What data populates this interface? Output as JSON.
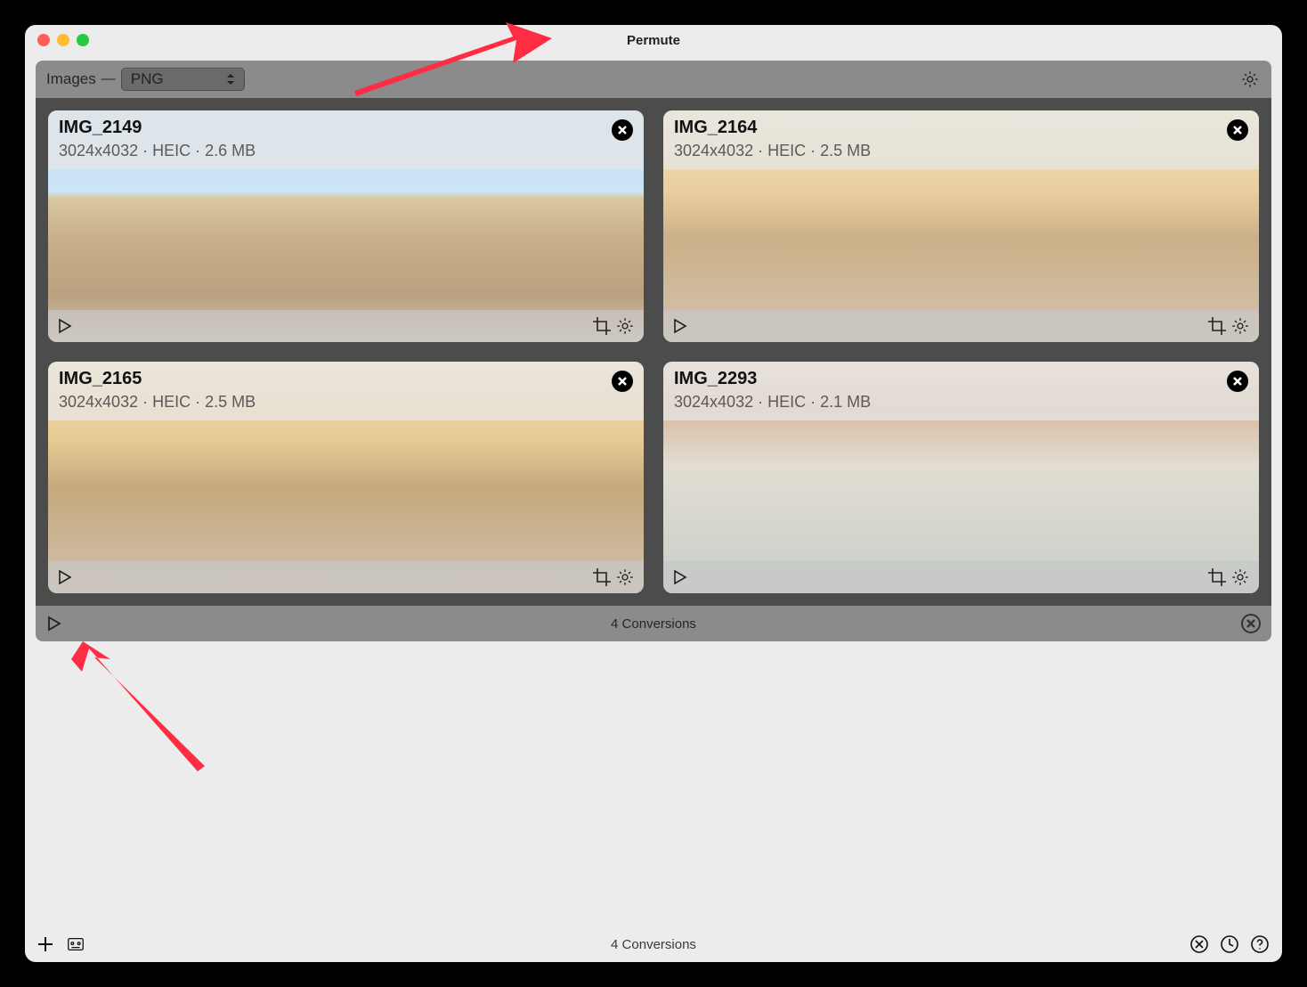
{
  "window": {
    "title": "Permute"
  },
  "panel": {
    "type_label": "Images",
    "format_selected": "PNG",
    "footer_text": "4 Conversions"
  },
  "cards": [
    {
      "name": "IMG_2149",
      "dimensions": "3024x4032",
      "format": "HEIC",
      "size": "2.6 MB",
      "scene": "scene1"
    },
    {
      "name": "IMG_2164",
      "dimensions": "3024x4032",
      "format": "HEIC",
      "size": "2.5 MB",
      "scene": "scene2"
    },
    {
      "name": "IMG_2165",
      "dimensions": "3024x4032",
      "format": "HEIC",
      "size": "2.5 MB",
      "scene": "scene3"
    },
    {
      "name": "IMG_2293",
      "dimensions": "3024x4032",
      "format": "HEIC",
      "size": "2.1 MB",
      "scene": "scene4"
    }
  ],
  "bottom_bar": {
    "status": "4 Conversions"
  }
}
